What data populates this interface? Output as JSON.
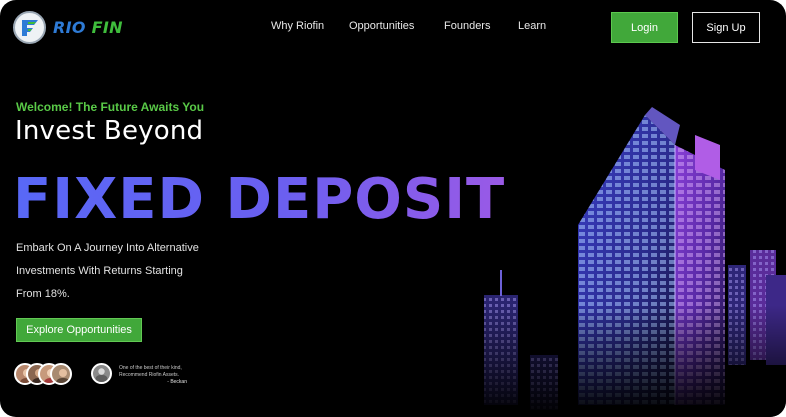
{
  "brand": {
    "name_part1": "RIO",
    "name_part2": "FIN",
    "logo_icon": "riofin-logo-icon"
  },
  "nav": {
    "links": [
      {
        "label": "Why Riofin"
      },
      {
        "label": "Opportunities"
      },
      {
        "label": "Founders"
      },
      {
        "label": "Learn"
      }
    ],
    "login_label": "Login",
    "signup_label": "Sign Up"
  },
  "hero": {
    "welcome": "Welcome! The Future Awaits You",
    "headline": "Invest Beyond",
    "highlight": "FIXED DEPOSIT",
    "description_lines": [
      "Embark On A Journey Into Alternative",
      "Investments  With Returns Starting",
      "From 18%."
    ],
    "cta_label": "Explore Opportunities"
  },
  "testimonial": {
    "line1": "One of the best of their kind,",
    "line2": "Recommend Riofin Assets.",
    "author": "- Beckan"
  },
  "colors": {
    "accent_green": "#41a83a",
    "welcome_green": "#59c947",
    "gradient_start": "#5868f6",
    "gradient_end": "#9a5ae6",
    "background": "#000000"
  }
}
